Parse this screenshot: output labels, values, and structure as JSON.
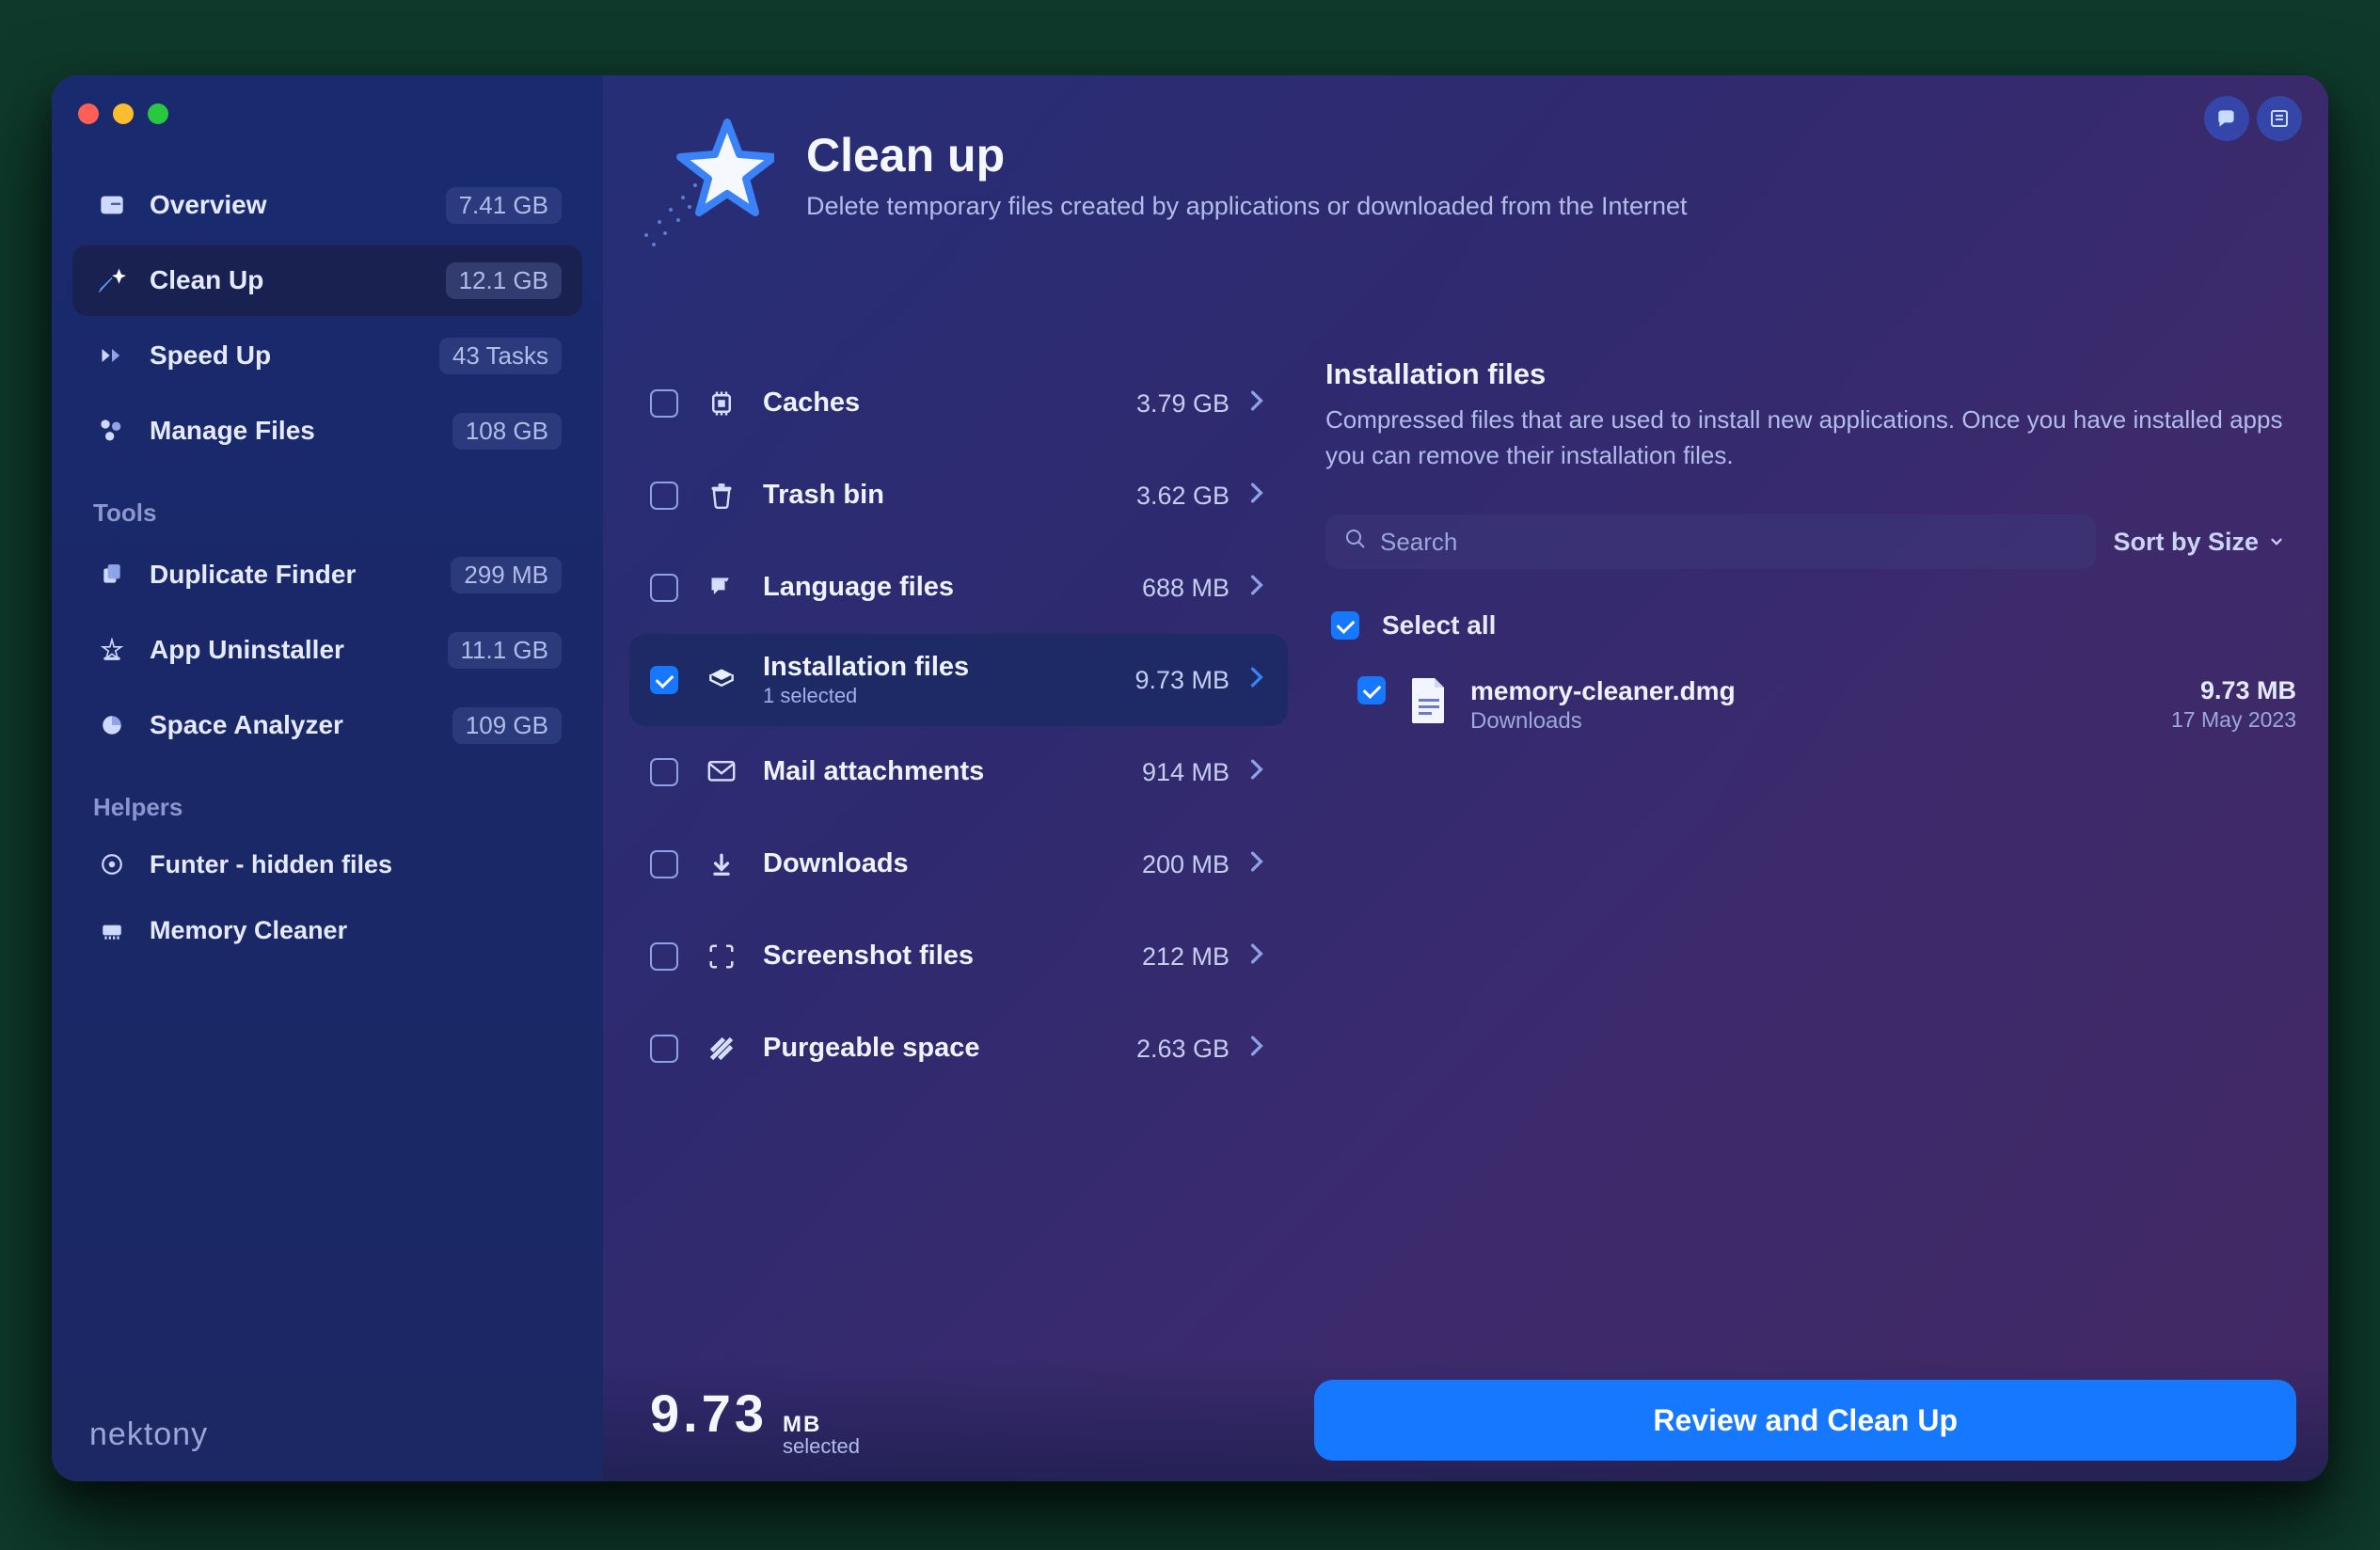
{
  "brand": "nektony",
  "header": {
    "title": "Clean up",
    "subtitle": "Delete temporary files created by applications or downloaded from the Internet"
  },
  "sidebar": {
    "main": [
      {
        "id": "overview",
        "label": "Overview",
        "badge": "7.41 GB"
      },
      {
        "id": "clean-up",
        "label": "Clean Up",
        "badge": "12.1 GB",
        "active": true
      },
      {
        "id": "speed-up",
        "label": "Speed Up",
        "badge": "43 Tasks"
      },
      {
        "id": "manage-files",
        "label": "Manage Files",
        "badge": "108 GB"
      }
    ],
    "tools_title": "Tools",
    "tools": [
      {
        "id": "duplicate-finder",
        "label": "Duplicate Finder",
        "badge": "299 MB"
      },
      {
        "id": "app-uninstaller",
        "label": "App Uninstaller",
        "badge": "11.1 GB"
      },
      {
        "id": "space-analyzer",
        "label": "Space Analyzer",
        "badge": "109 GB"
      }
    ],
    "helpers_title": "Helpers",
    "helpers": [
      {
        "id": "funter",
        "label": "Funter - hidden files"
      },
      {
        "id": "memory-cleaner",
        "label": "Memory Cleaner"
      }
    ]
  },
  "categories": [
    {
      "id": "caches",
      "label": "Caches",
      "size": "3.79 GB",
      "checked": false
    },
    {
      "id": "trash-bin",
      "label": "Trash bin",
      "size": "3.62 GB",
      "checked": false
    },
    {
      "id": "language-files",
      "label": "Language files",
      "size": "688 MB",
      "checked": false
    },
    {
      "id": "installation",
      "label": "Installation files",
      "size": "9.73 MB",
      "checked": true,
      "selected": true,
      "sub": "1 selected"
    },
    {
      "id": "mail-attachments",
      "label": "Mail attachments",
      "size": "914 MB",
      "checked": false
    },
    {
      "id": "downloads",
      "label": "Downloads",
      "size": "200 MB",
      "checked": false
    },
    {
      "id": "screenshot",
      "label": "Screenshot files",
      "size": "212 MB",
      "checked": false
    },
    {
      "id": "purgeable",
      "label": "Purgeable space",
      "size": "2.63 GB",
      "checked": false
    }
  ],
  "detail": {
    "title": "Installation files",
    "desc": "Compressed files that are used to install new applications. Once you have installed apps you can remove their installation files.",
    "search_placeholder": "Search",
    "sort": "Sort by Size",
    "select_all": "Select all",
    "files": [
      {
        "name": "memory-cleaner.dmg",
        "location": "Downloads",
        "size": "9.73 MB",
        "date": "17 May 2023",
        "checked": true
      }
    ]
  },
  "footer": {
    "total_value": "9.73",
    "total_unit": "MB",
    "total_label": "selected",
    "cta": "Review and Clean Up"
  }
}
